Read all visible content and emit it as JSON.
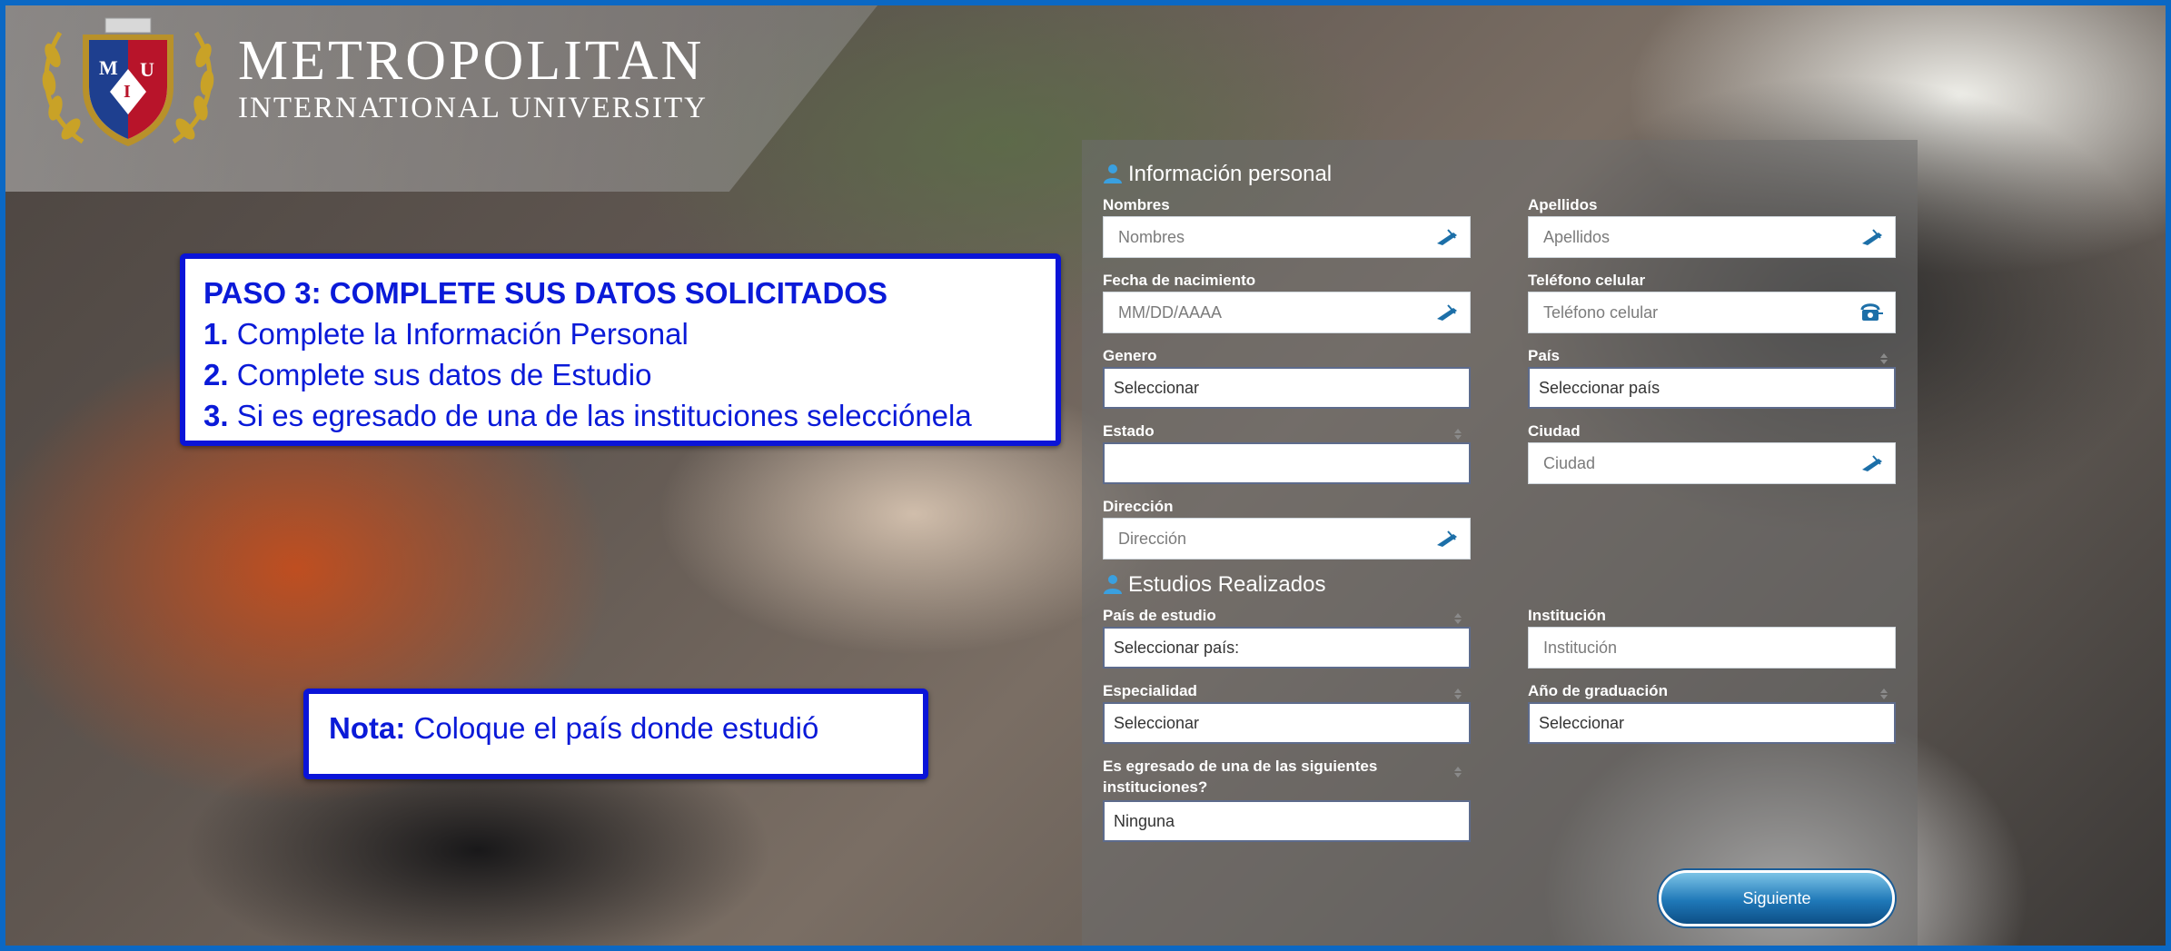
{
  "header": {
    "logo_name_line1": "METROPOLITAN",
    "logo_name_line2": "INTERNATIONAL UNIVERSITY",
    "crest_letters": [
      "M",
      "I",
      "U"
    ]
  },
  "instructions": {
    "title": "PASO 3: COMPLETE SUS DATOS SOLICITADOS",
    "steps": [
      {
        "num": "1.",
        "text": "Complete la Información Personal"
      },
      {
        "num": "2.",
        "text": "Complete sus datos de Estudio"
      },
      {
        "num": "3.",
        "text": "Si es egresado de una de las instituciones selecciónela"
      }
    ]
  },
  "note": {
    "label": "Nota:",
    "text": "Coloque el país donde estudió"
  },
  "personal": {
    "title": "Información personal",
    "nombres": {
      "label": "Nombres",
      "placeholder": "Nombres"
    },
    "apellidos": {
      "label": "Apellidos",
      "placeholder": "Apellidos"
    },
    "fecha": {
      "label": "Fecha de nacimiento",
      "placeholder": "MM/DD/AAAA"
    },
    "telefono": {
      "label": "Teléfono celular",
      "placeholder": "Teléfono celular"
    },
    "genero": {
      "label": "Genero",
      "value": "Seleccionar"
    },
    "pais": {
      "label": "País",
      "value": "Seleccionar país"
    },
    "estado": {
      "label": "Estado",
      "value": ""
    },
    "ciudad": {
      "label": "Ciudad",
      "placeholder": "Ciudad"
    },
    "direccion": {
      "label": "Dirección",
      "placeholder": "Dirección"
    }
  },
  "studies": {
    "title": "Estudios Realizados",
    "pais_estudio": {
      "label": "País de estudio",
      "value": "Seleccionar país:"
    },
    "institucion": {
      "label": "Institución",
      "placeholder": "Institución"
    },
    "especialidad": {
      "label": "Especialidad",
      "value": "Seleccionar"
    },
    "anio": {
      "label": "Año de graduación",
      "value": "Seleccionar"
    },
    "egresado": {
      "label_line1": "Es egresado de una de las siguientes",
      "label_line2": "instituciones?",
      "value": "Ninguna"
    }
  },
  "buttons": {
    "next": "Siguiente"
  },
  "colors": {
    "accent_blue": "#0a1ad8",
    "frame_blue": "#0b68c4",
    "icon_blue": "#1c6fa8",
    "button_blue": "#1f78b8"
  },
  "icons": {
    "field_icon": "pen-icon",
    "phone_icon": "phone-icon",
    "section_icon": "person-icon",
    "sort_icon": "sort-icon"
  }
}
